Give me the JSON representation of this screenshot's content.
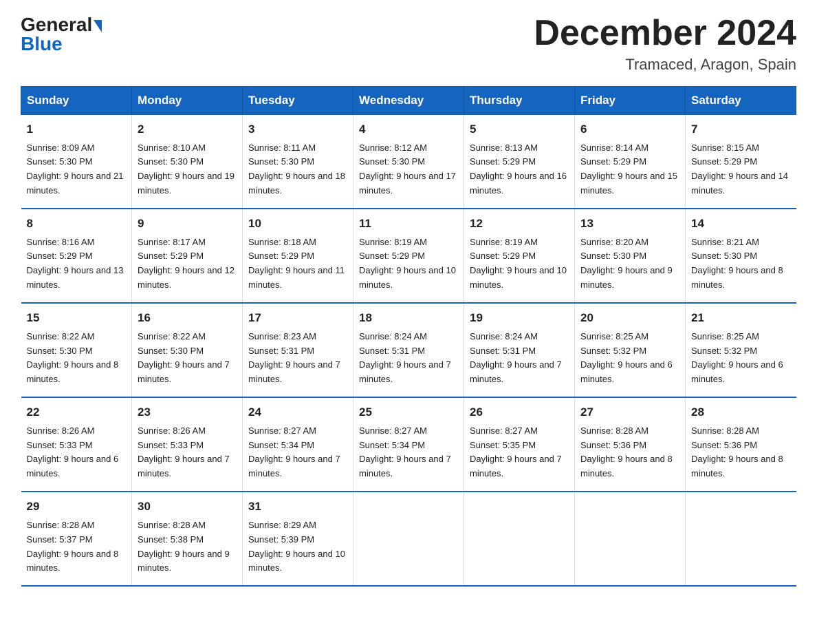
{
  "header": {
    "logo_general": "General",
    "logo_blue": "Blue",
    "month": "December 2024",
    "location": "Tramaced, Aragon, Spain"
  },
  "days_of_week": [
    "Sunday",
    "Monday",
    "Tuesday",
    "Wednesday",
    "Thursday",
    "Friday",
    "Saturday"
  ],
  "weeks": [
    [
      {
        "day": "1",
        "sunrise": "Sunrise: 8:09 AM",
        "sunset": "Sunset: 5:30 PM",
        "daylight": "Daylight: 9 hours and 21 minutes."
      },
      {
        "day": "2",
        "sunrise": "Sunrise: 8:10 AM",
        "sunset": "Sunset: 5:30 PM",
        "daylight": "Daylight: 9 hours and 19 minutes."
      },
      {
        "day": "3",
        "sunrise": "Sunrise: 8:11 AM",
        "sunset": "Sunset: 5:30 PM",
        "daylight": "Daylight: 9 hours and 18 minutes."
      },
      {
        "day": "4",
        "sunrise": "Sunrise: 8:12 AM",
        "sunset": "Sunset: 5:30 PM",
        "daylight": "Daylight: 9 hours and 17 minutes."
      },
      {
        "day": "5",
        "sunrise": "Sunrise: 8:13 AM",
        "sunset": "Sunset: 5:29 PM",
        "daylight": "Daylight: 9 hours and 16 minutes."
      },
      {
        "day": "6",
        "sunrise": "Sunrise: 8:14 AM",
        "sunset": "Sunset: 5:29 PM",
        "daylight": "Daylight: 9 hours and 15 minutes."
      },
      {
        "day": "7",
        "sunrise": "Sunrise: 8:15 AM",
        "sunset": "Sunset: 5:29 PM",
        "daylight": "Daylight: 9 hours and 14 minutes."
      }
    ],
    [
      {
        "day": "8",
        "sunrise": "Sunrise: 8:16 AM",
        "sunset": "Sunset: 5:29 PM",
        "daylight": "Daylight: 9 hours and 13 minutes."
      },
      {
        "day": "9",
        "sunrise": "Sunrise: 8:17 AM",
        "sunset": "Sunset: 5:29 PM",
        "daylight": "Daylight: 9 hours and 12 minutes."
      },
      {
        "day": "10",
        "sunrise": "Sunrise: 8:18 AM",
        "sunset": "Sunset: 5:29 PM",
        "daylight": "Daylight: 9 hours and 11 minutes."
      },
      {
        "day": "11",
        "sunrise": "Sunrise: 8:19 AM",
        "sunset": "Sunset: 5:29 PM",
        "daylight": "Daylight: 9 hours and 10 minutes."
      },
      {
        "day": "12",
        "sunrise": "Sunrise: 8:19 AM",
        "sunset": "Sunset: 5:29 PM",
        "daylight": "Daylight: 9 hours and 10 minutes."
      },
      {
        "day": "13",
        "sunrise": "Sunrise: 8:20 AM",
        "sunset": "Sunset: 5:30 PM",
        "daylight": "Daylight: 9 hours and 9 minutes."
      },
      {
        "day": "14",
        "sunrise": "Sunrise: 8:21 AM",
        "sunset": "Sunset: 5:30 PM",
        "daylight": "Daylight: 9 hours and 8 minutes."
      }
    ],
    [
      {
        "day": "15",
        "sunrise": "Sunrise: 8:22 AM",
        "sunset": "Sunset: 5:30 PM",
        "daylight": "Daylight: 9 hours and 8 minutes."
      },
      {
        "day": "16",
        "sunrise": "Sunrise: 8:22 AM",
        "sunset": "Sunset: 5:30 PM",
        "daylight": "Daylight: 9 hours and 7 minutes."
      },
      {
        "day": "17",
        "sunrise": "Sunrise: 8:23 AM",
        "sunset": "Sunset: 5:31 PM",
        "daylight": "Daylight: 9 hours and 7 minutes."
      },
      {
        "day": "18",
        "sunrise": "Sunrise: 8:24 AM",
        "sunset": "Sunset: 5:31 PM",
        "daylight": "Daylight: 9 hours and 7 minutes."
      },
      {
        "day": "19",
        "sunrise": "Sunrise: 8:24 AM",
        "sunset": "Sunset: 5:31 PM",
        "daylight": "Daylight: 9 hours and 7 minutes."
      },
      {
        "day": "20",
        "sunrise": "Sunrise: 8:25 AM",
        "sunset": "Sunset: 5:32 PM",
        "daylight": "Daylight: 9 hours and 6 minutes."
      },
      {
        "day": "21",
        "sunrise": "Sunrise: 8:25 AM",
        "sunset": "Sunset: 5:32 PM",
        "daylight": "Daylight: 9 hours and 6 minutes."
      }
    ],
    [
      {
        "day": "22",
        "sunrise": "Sunrise: 8:26 AM",
        "sunset": "Sunset: 5:33 PM",
        "daylight": "Daylight: 9 hours and 6 minutes."
      },
      {
        "day": "23",
        "sunrise": "Sunrise: 8:26 AM",
        "sunset": "Sunset: 5:33 PM",
        "daylight": "Daylight: 9 hours and 7 minutes."
      },
      {
        "day": "24",
        "sunrise": "Sunrise: 8:27 AM",
        "sunset": "Sunset: 5:34 PM",
        "daylight": "Daylight: 9 hours and 7 minutes."
      },
      {
        "day": "25",
        "sunrise": "Sunrise: 8:27 AM",
        "sunset": "Sunset: 5:34 PM",
        "daylight": "Daylight: 9 hours and 7 minutes."
      },
      {
        "day": "26",
        "sunrise": "Sunrise: 8:27 AM",
        "sunset": "Sunset: 5:35 PM",
        "daylight": "Daylight: 9 hours and 7 minutes."
      },
      {
        "day": "27",
        "sunrise": "Sunrise: 8:28 AM",
        "sunset": "Sunset: 5:36 PM",
        "daylight": "Daylight: 9 hours and 8 minutes."
      },
      {
        "day": "28",
        "sunrise": "Sunrise: 8:28 AM",
        "sunset": "Sunset: 5:36 PM",
        "daylight": "Daylight: 9 hours and 8 minutes."
      }
    ],
    [
      {
        "day": "29",
        "sunrise": "Sunrise: 8:28 AM",
        "sunset": "Sunset: 5:37 PM",
        "daylight": "Daylight: 9 hours and 8 minutes."
      },
      {
        "day": "30",
        "sunrise": "Sunrise: 8:28 AM",
        "sunset": "Sunset: 5:38 PM",
        "daylight": "Daylight: 9 hours and 9 minutes."
      },
      {
        "day": "31",
        "sunrise": "Sunrise: 8:29 AM",
        "sunset": "Sunset: 5:39 PM",
        "daylight": "Daylight: 9 hours and 10 minutes."
      },
      {
        "day": "",
        "sunrise": "",
        "sunset": "",
        "daylight": ""
      },
      {
        "day": "",
        "sunrise": "",
        "sunset": "",
        "daylight": ""
      },
      {
        "day": "",
        "sunrise": "",
        "sunset": "",
        "daylight": ""
      },
      {
        "day": "",
        "sunrise": "",
        "sunset": "",
        "daylight": ""
      }
    ]
  ]
}
